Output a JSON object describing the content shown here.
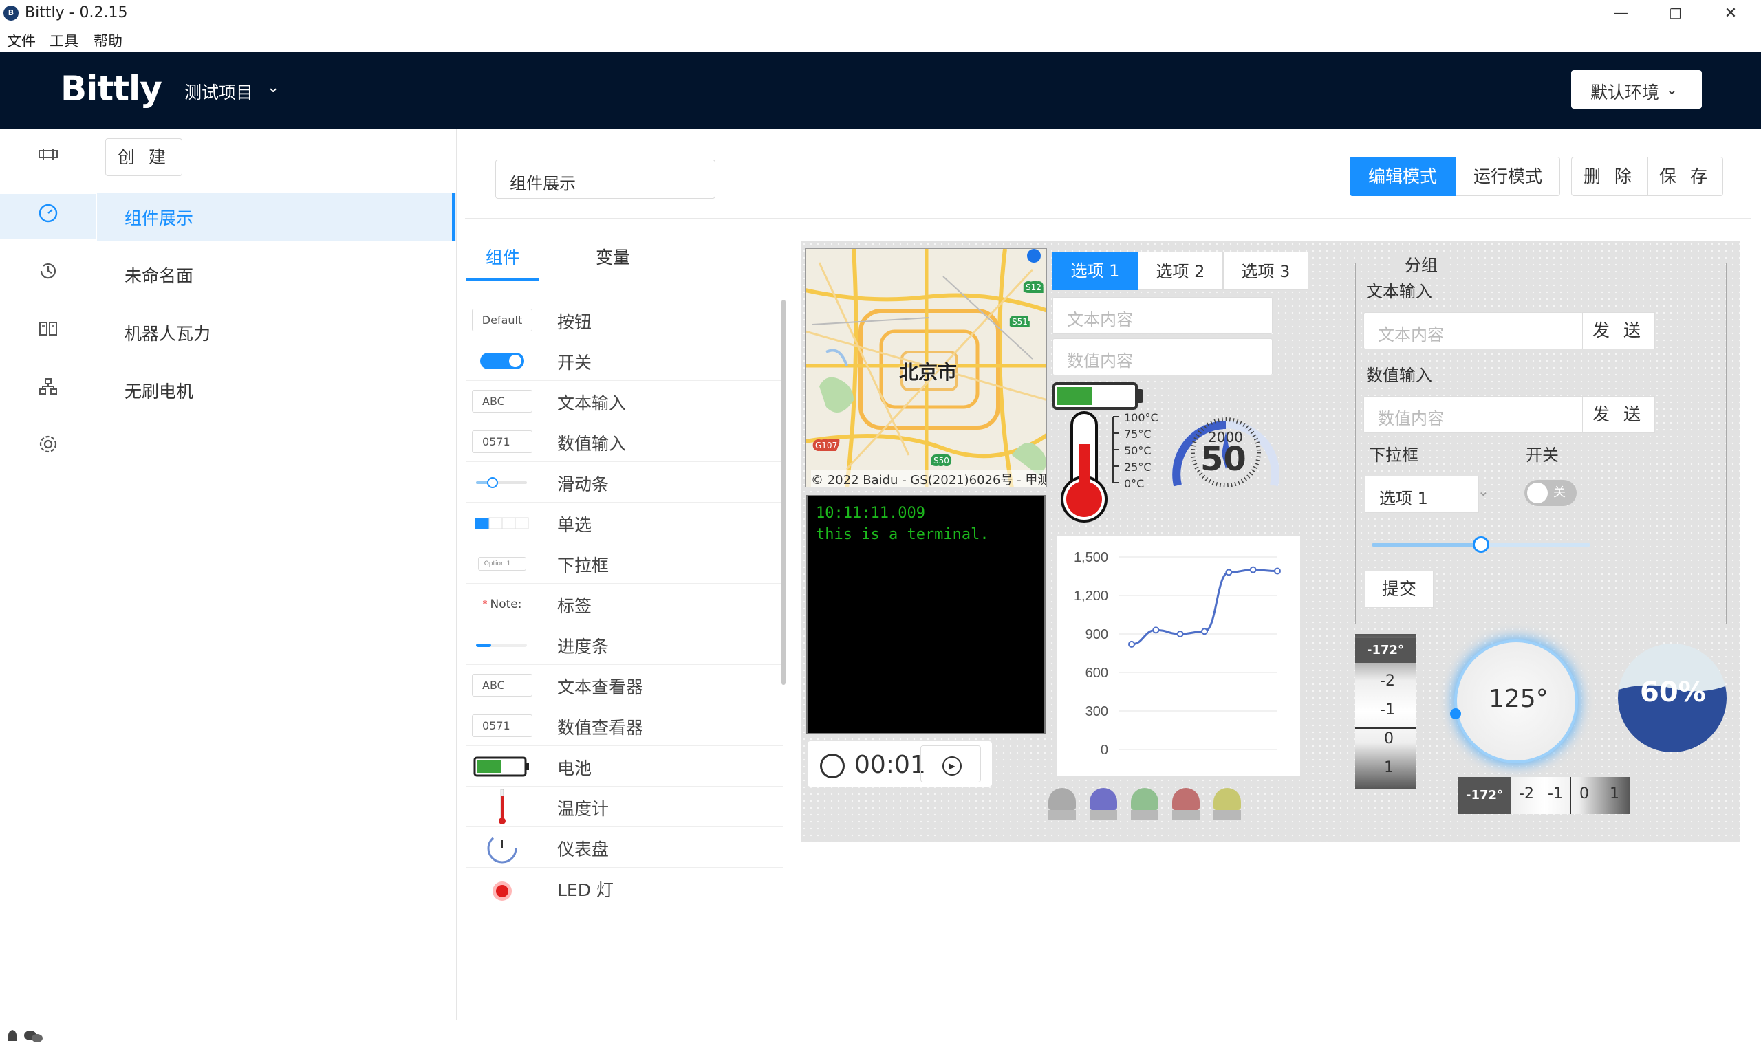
{
  "window": {
    "title": "Bittly - 0.2.15",
    "logo_text": "B",
    "minimize": "—",
    "restore": "❐",
    "close": "✕"
  },
  "menu": [
    "文件",
    "工具",
    "帮助"
  ],
  "header": {
    "brand": "Bittly",
    "project": "测试项目",
    "environment": "默认环境"
  },
  "sidebar": {
    "create_label": "创 建",
    "pages": [
      "组件展示",
      "未命名面",
      "机器人瓦力",
      "无刷电机"
    ],
    "active_index": 0
  },
  "toolbar": {
    "page_name": "组件展示",
    "edit_mode": "编辑模式",
    "run_mode": "运行模式",
    "delete": "删 除",
    "save": "保 存"
  },
  "panel": {
    "tabs": [
      "组件",
      "变量"
    ],
    "components": [
      {
        "label": "按钮",
        "preview": "Default"
      },
      {
        "label": "开关",
        "preview": ""
      },
      {
        "label": "文本输入",
        "preview": "ABC"
      },
      {
        "label": "数值输入",
        "preview": "0571"
      },
      {
        "label": "滑动条",
        "preview": ""
      },
      {
        "label": "单选",
        "preview": ""
      },
      {
        "label": "下拉框",
        "preview": "Option 1"
      },
      {
        "label": "标签",
        "preview": "Note:"
      },
      {
        "label": "进度条",
        "preview": ""
      },
      {
        "label": "文本查看器",
        "preview": "ABC"
      },
      {
        "label": "数值查看器",
        "preview": "0571"
      },
      {
        "label": "电池",
        "preview": ""
      },
      {
        "label": "温度计",
        "preview": ""
      },
      {
        "label": "仪表盘",
        "preview": ""
      },
      {
        "label": "LED 灯",
        "preview": ""
      }
    ]
  },
  "canvas": {
    "map": {
      "city": "北京市",
      "copyright": "© 2022 Baidu - GS(2021)6026号 - 甲测",
      "badges": [
        "S12",
        "S51",
        "G107",
        "S50"
      ]
    },
    "terminal": {
      "lines": [
        "10:11:11.009",
        "this is a terminal."
      ]
    },
    "timer": {
      "value": "00:01"
    },
    "tabs": [
      "选项 1",
      "选项 2",
      "选项 3"
    ],
    "text_input_placeholder": "文本内容",
    "number_input_placeholder": "数值内容",
    "battery_level": 0.45,
    "thermometer": {
      "scale": [
        "100°C",
        "75°C",
        "50°C",
        "25°C",
        "0°C"
      ]
    },
    "gauge": {
      "value": "50",
      "scale_text": "2000",
      "level": 0.4
    },
    "leds": [
      "#aaaaaa",
      "#7070c8",
      "#90c090",
      "#c07070",
      "#c8c870"
    ],
    "group": {
      "title": "分组",
      "text_label": "文本输入",
      "text_placeholder": "文本内容",
      "text_send": "发 送",
      "num_label": "数值输入",
      "num_placeholder": "数值内容",
      "num_send": "发 送",
      "select_label": "下拉框",
      "select_value": "选项 1",
      "switch_label": "开关",
      "switch_text": "关",
      "slider_value": 0.5,
      "submit": "提交"
    },
    "ruler_vertical": {
      "current": "-172°",
      "ticks": [
        "-2",
        "-1",
        "0",
        "1"
      ]
    },
    "ruler_horizontal": {
      "current": "-172°",
      "ticks": [
        "-2",
        "-1",
        "0",
        "1"
      ]
    },
    "knob": {
      "value": "125°"
    },
    "liquid": {
      "value": "60%",
      "level": 0.6
    }
  },
  "chart_data": {
    "type": "line",
    "x": [
      1,
      2,
      3,
      4,
      5,
      6,
      7
    ],
    "values": [
      820,
      930,
      900,
      920,
      1380,
      1400,
      1390
    ],
    "ylim": [
      0,
      1500
    ],
    "yticks": [
      "1,500",
      "1,200",
      "900",
      "600",
      "300",
      "0"
    ],
    "color": "#4e6fc8"
  },
  "colors": {
    "accent": "#1890ff",
    "header": "#02142c"
  }
}
